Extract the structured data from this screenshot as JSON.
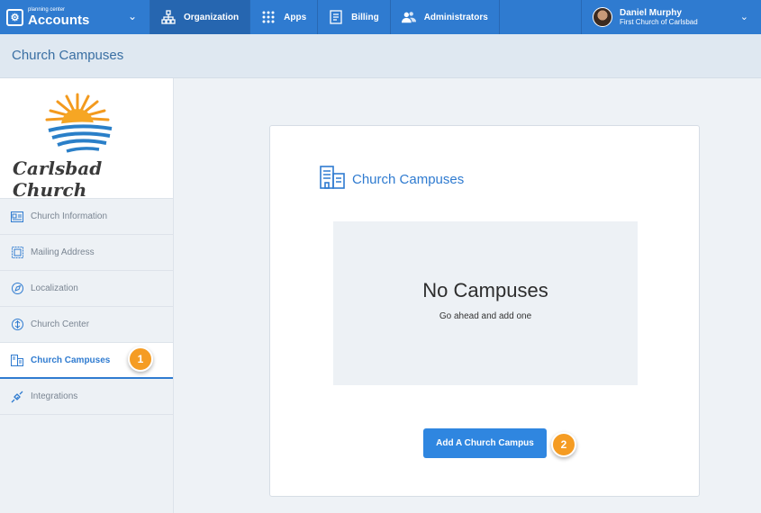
{
  "topbar": {
    "brand_small": "planning center",
    "brand_name": "Accounts",
    "nav": [
      {
        "label": "Organization",
        "icon": "org-chart-icon"
      },
      {
        "label": "Apps",
        "icon": "grid-icon"
      },
      {
        "label": "Billing",
        "icon": "receipt-icon"
      },
      {
        "label": "Administrators",
        "icon": "users-icon"
      }
    ],
    "user": {
      "name": "Daniel Murphy",
      "org": "First Church of Carlsbad"
    }
  },
  "page": {
    "title": "Church Campuses"
  },
  "sidebar": {
    "logo_text": "Carlsbad Church",
    "items": [
      {
        "label": "Church Information",
        "icon": "id-card-icon"
      },
      {
        "label": "Mailing Address",
        "icon": "stamp-icon"
      },
      {
        "label": "Localization",
        "icon": "compass-icon"
      },
      {
        "label": "Church Center",
        "icon": "church-center-icon"
      },
      {
        "label": "Church Campuses",
        "icon": "buildings-icon"
      },
      {
        "label": "Integrations",
        "icon": "plug-icon"
      }
    ]
  },
  "main": {
    "card_title": "Church Campuses",
    "empty_title": "No Campuses",
    "empty_subtitle": "Go ahead and add one",
    "add_button": "Add A Church Campus"
  },
  "callouts": {
    "first": "1",
    "second": "2"
  },
  "colors": {
    "accent": "#2f7bd0",
    "callout": "#f59c23"
  }
}
